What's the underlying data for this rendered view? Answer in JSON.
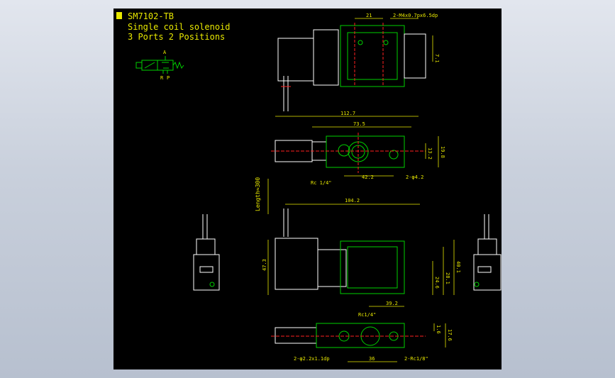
{
  "colors": {
    "background": "#000000",
    "window": "#c9d0dc",
    "text": "#e8e800",
    "outline": "#ffffff",
    "body": "#00d000",
    "centerline": "#ff2020",
    "dimension": "#e8e800"
  },
  "header": {
    "title": "SM7102-TB",
    "subtitle_1": "Single coil solenoid",
    "subtitle_2": "3 Ports 2 Positions"
  },
  "symbol": {
    "port_a": "A",
    "port_r": "R",
    "port_p": "P"
  },
  "labels": {
    "top_width": "21",
    "top_thread": "2-M4x0.7px6.5dp",
    "top_height": "7.1",
    "overall_len": "112.7",
    "body_len": "73.5",
    "h_13": "13.2",
    "h_19": "19.8",
    "port_rc": "Rc 1/4\"",
    "spacing_42": "42.2",
    "hole_dia": "2-φ4.2",
    "cable_len": "Length≈300",
    "front_len": "104.2",
    "front_h": "47.3",
    "h_24": "24.6",
    "h_28": "28.1",
    "h_40": "40.1",
    "front_base": "39.2",
    "bottom_port": "Rc1/4\"",
    "bottom_small": "1.6",
    "bottom_17": "17.6",
    "bottom_holes": "2-φ2.2x1.1dp",
    "bottom_36": "36",
    "bottom_rc18": "2-Rc1/8\""
  }
}
